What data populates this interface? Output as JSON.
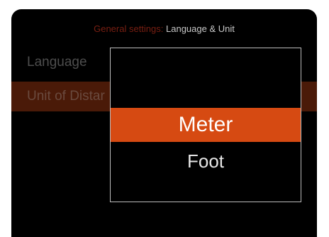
{
  "header": {
    "parent": "General settings:",
    "current": "Language & Unit"
  },
  "settings": {
    "language_label": "Language",
    "distance_label": "Unit of Distar"
  },
  "popup": {
    "options": [
      "Meter",
      "Foot"
    ],
    "selected": "Meter"
  },
  "colors": {
    "background": "#000000",
    "accent": "#d64a12",
    "highlight_row": "#4a1a08",
    "popup_border": "#bdbdbd"
  }
}
